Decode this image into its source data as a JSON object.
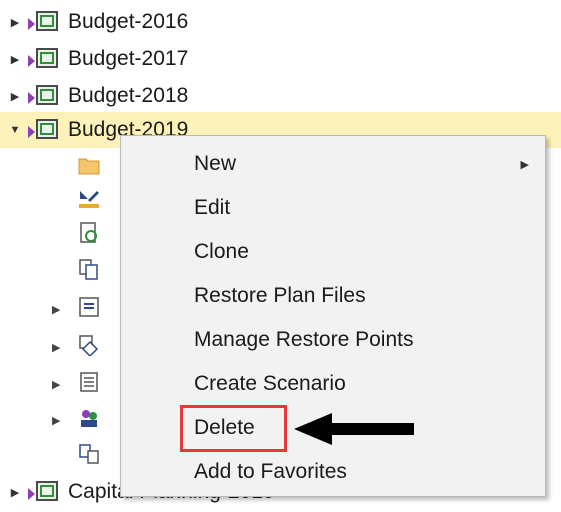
{
  "tree": {
    "items": [
      {
        "label": "Budget-2016",
        "expanded": false
      },
      {
        "label": "Budget-2017",
        "expanded": false
      },
      {
        "label": "Budget-2018",
        "expanded": false
      },
      {
        "label": "Budget-2019",
        "expanded": true,
        "selected": true
      },
      {
        "label": "Capital Planning-2019",
        "expanded": false
      }
    ],
    "children_icons": [
      "folder-icon",
      "edit-drawing-icon",
      "refresh-document-icon",
      "copy-document-icon",
      "import-icon",
      "diamond-shape-icon",
      "list-icon",
      "users-icon",
      "document-grid-icon"
    ]
  },
  "context_menu": {
    "items": [
      {
        "label": "New",
        "has_submenu": true
      },
      {
        "label": "Edit",
        "has_submenu": false
      },
      {
        "label": "Clone",
        "has_submenu": false
      },
      {
        "label": "Restore Plan Files",
        "has_submenu": false
      },
      {
        "label": "Manage Restore Points",
        "has_submenu": false
      },
      {
        "label": "Create Scenario",
        "has_submenu": false
      },
      {
        "label": "Delete",
        "has_submenu": false,
        "annotated": true
      },
      {
        "label": "Add to Favorites",
        "has_submenu": false
      }
    ],
    "annotation_color": "#e23a3a"
  }
}
